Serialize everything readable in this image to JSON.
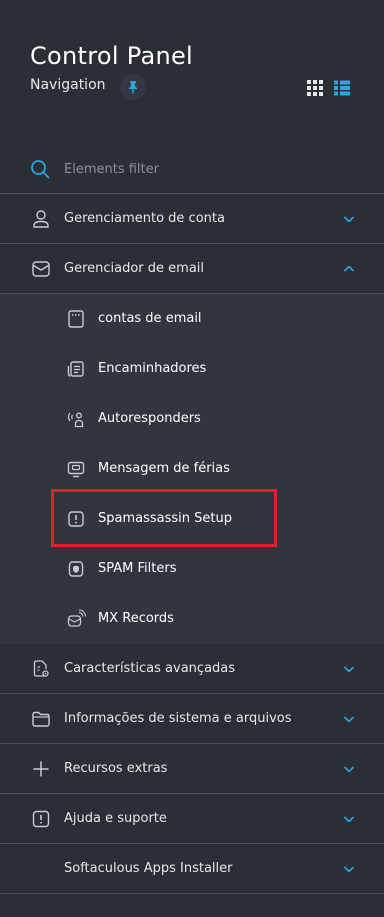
{
  "header": {
    "title": "Control Panel",
    "subtitle": "Navigation",
    "icons": [
      "pin-icon",
      "grid-view-icon",
      "list-view-icon"
    ]
  },
  "filter": {
    "placeholder": "Elements filter",
    "icon": "search-icon"
  },
  "menu": {
    "items": [
      {
        "label": "Gerenciamento de conta",
        "icon": "user-icon",
        "expanded": false
      },
      {
        "label": "Gerenciador de email",
        "icon": "envelope-icon",
        "expanded": true
      },
      {
        "label": "Características avançadas",
        "icon": "document-gear-icon",
        "expanded": false
      },
      {
        "label": "Informações de sistema e arquivos",
        "icon": "folder-icon",
        "expanded": false
      },
      {
        "label": "Recursos extras",
        "icon": "plus-icon",
        "expanded": false
      },
      {
        "label": "Ajuda e suporte",
        "icon": "alert-icon",
        "expanded": false
      },
      {
        "label": "Softaculous Apps Installer",
        "icon": "",
        "expanded": false
      }
    ],
    "email_submenu": [
      {
        "label": "contas de email",
        "icon": "email-account-icon"
      },
      {
        "label": "Encaminhadores",
        "icon": "forwarder-icon"
      },
      {
        "label": "Autoresponders",
        "icon": "autoresponder-icon"
      },
      {
        "label": "Mensagem de férias",
        "icon": "vacation-message-icon"
      },
      {
        "label": "Spamassassin Setup",
        "icon": "spamassassin-icon",
        "highlighted": true
      },
      {
        "label": "SPAM Filters",
        "icon": "spam-filter-icon"
      },
      {
        "label": "MX Records",
        "icon": "mx-records-icon"
      }
    ]
  },
  "colors": {
    "background": "#2b2e35",
    "submenu_background": "#31353d",
    "accent": "#2aa6e0",
    "highlight": "#e0202a",
    "divider": "#4a4e58"
  }
}
